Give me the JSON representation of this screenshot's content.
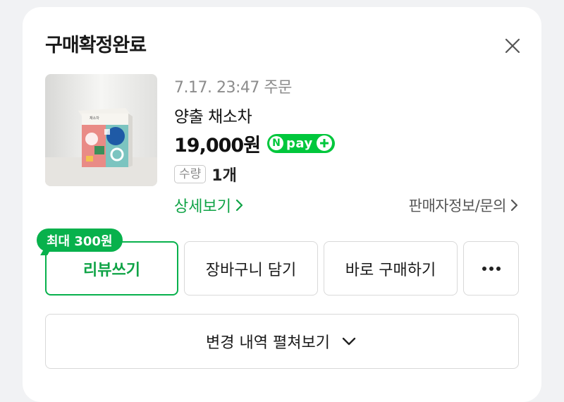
{
  "header": {
    "title": "구매확정완료",
    "close_icon": "close-icon"
  },
  "order": {
    "date": "7.17. 23:47 주문",
    "product_name": "양출 채소차",
    "price": "19,000원",
    "npay_badge": {
      "n": "N",
      "text": "pay",
      "plus": "plus-icon",
      "color": "#00c73c"
    },
    "quantity_label": "수량",
    "quantity_value": "1개",
    "detail_link": "상세보기",
    "seller_link": "판매자정보/문의"
  },
  "actions": {
    "reward_badge": "최대 300원",
    "review": "리뷰쓰기",
    "cart": "장바구니 담기",
    "buy_now": "바로 구매하기",
    "more_icon": "more-dots-icon"
  },
  "history": {
    "label": "변경 내역 펼쳐보기",
    "icon": "chevron-down-icon"
  },
  "colors": {
    "accent_green": "#08b14c",
    "link_green": "#0fa346",
    "background": "#f1f2f4"
  }
}
